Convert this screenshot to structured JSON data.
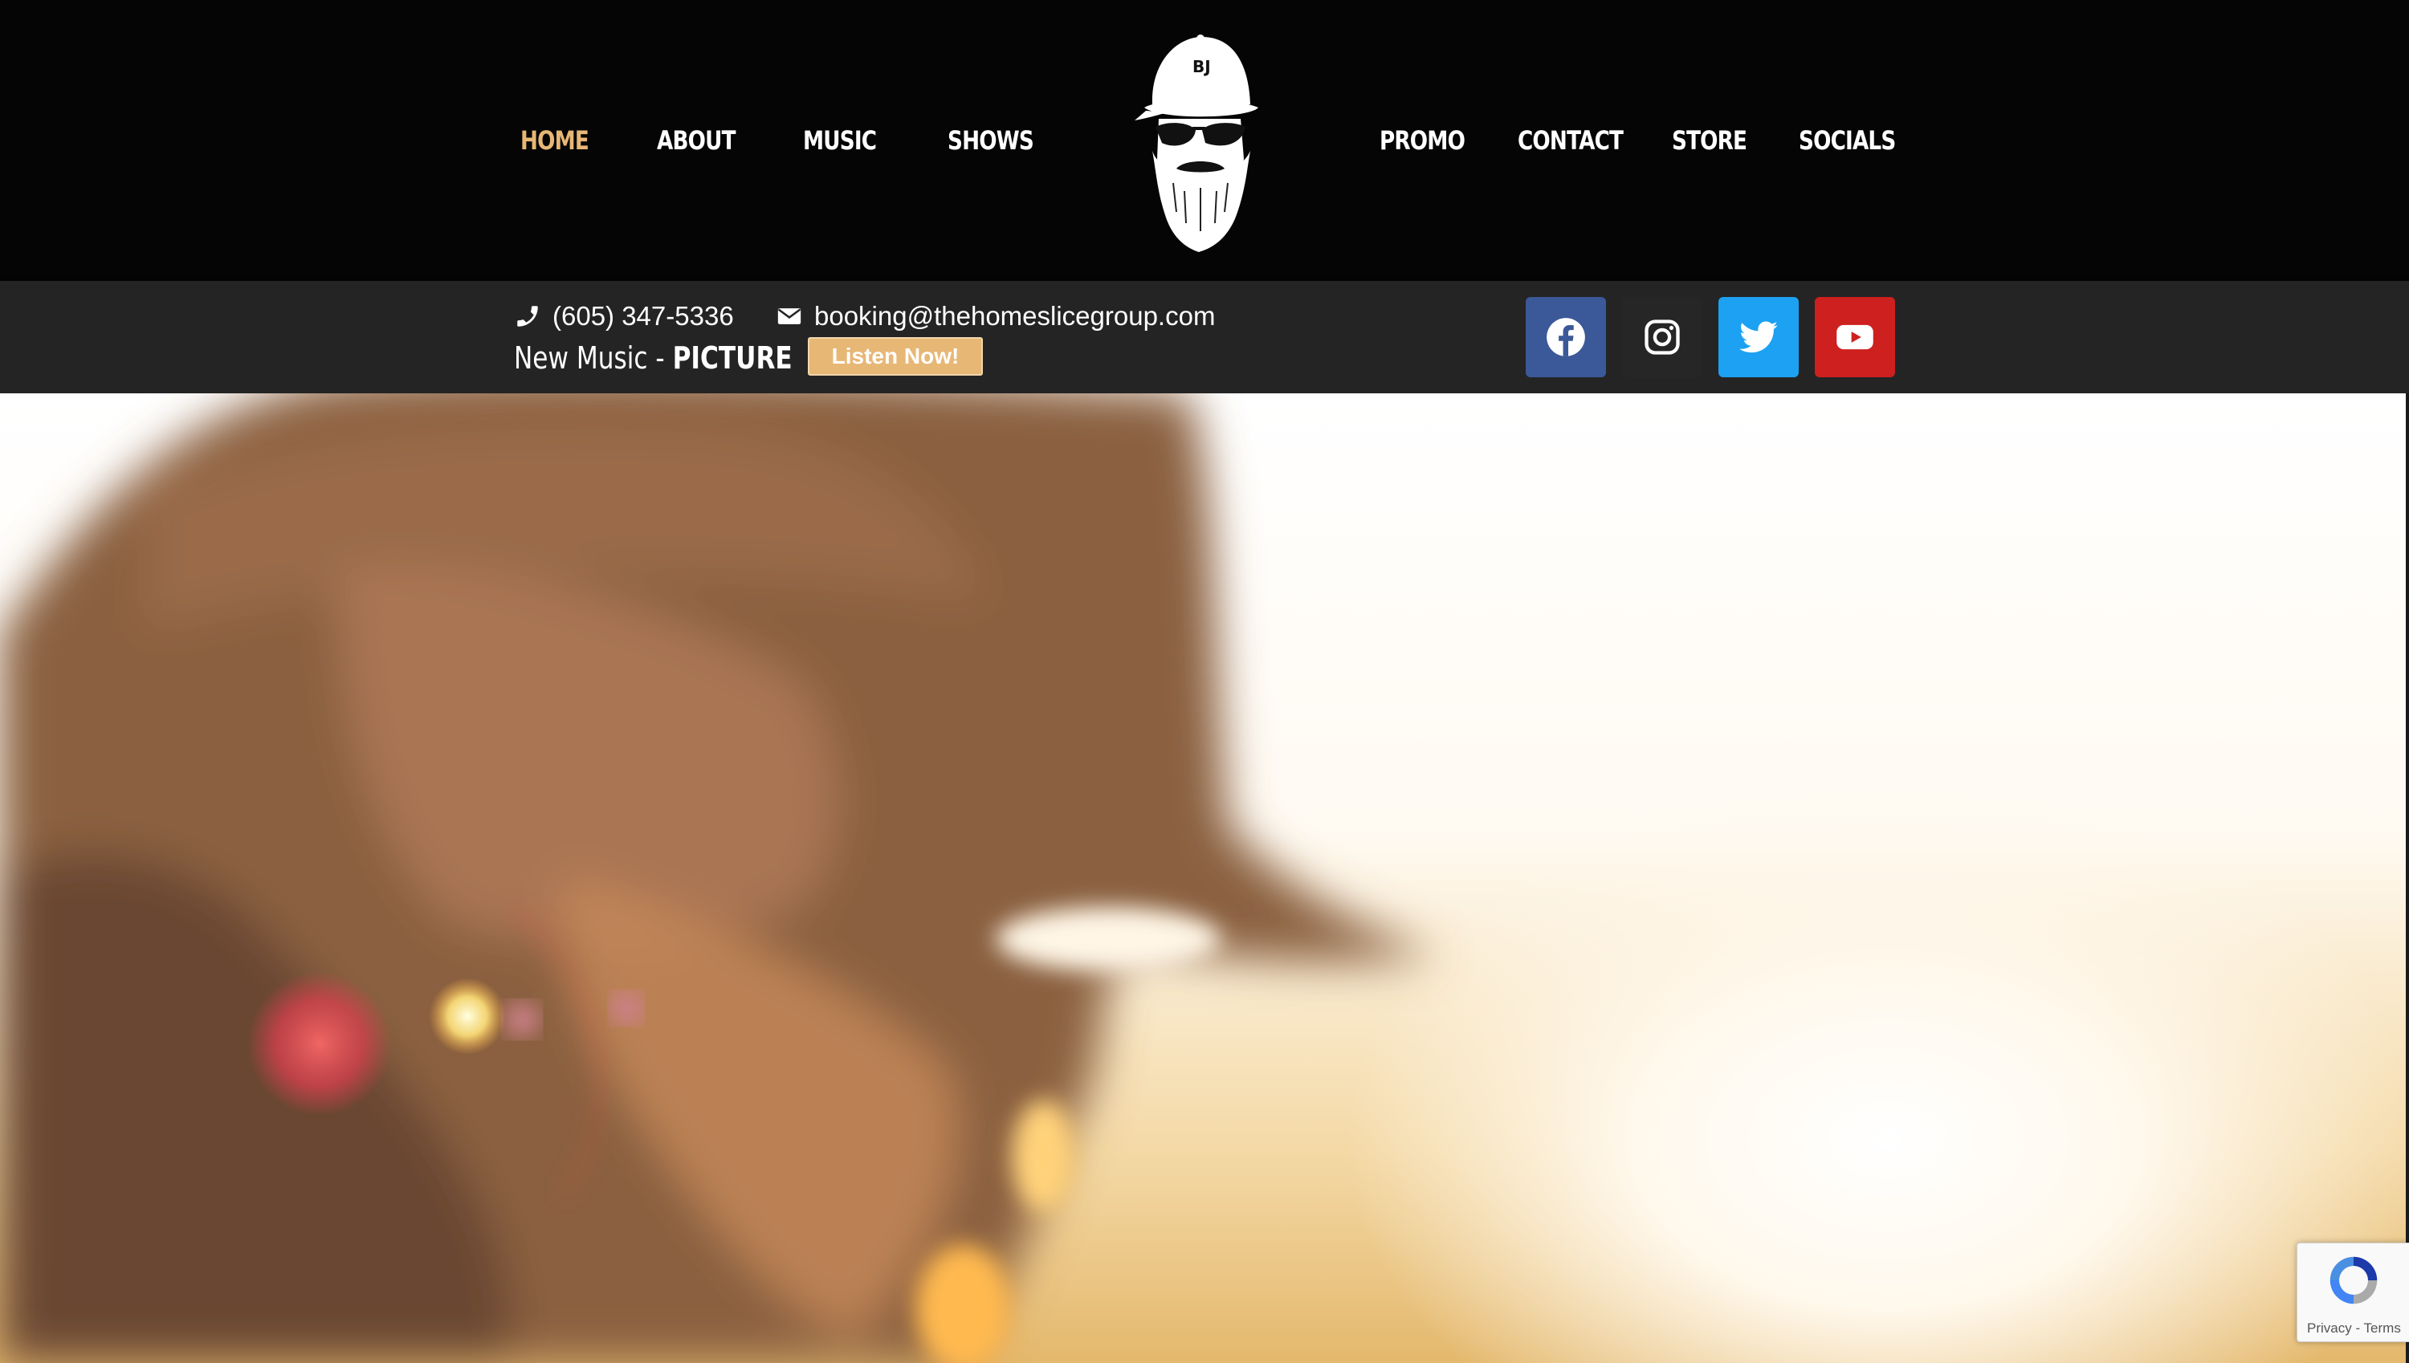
{
  "nav": {
    "left": [
      {
        "label": "HOME",
        "active": true
      },
      {
        "label": "ABOUT",
        "active": false
      },
      {
        "label": "MUSIC",
        "active": false
      },
      {
        "label": "SHOWS",
        "active": false
      }
    ],
    "right": [
      {
        "label": "PROMO",
        "active": false
      },
      {
        "label": "CONTACT",
        "active": false
      },
      {
        "label": "STORE",
        "active": false
      },
      {
        "label": "SOCIALS",
        "active": false
      }
    ],
    "active_color": "#e7b775",
    "logo": {
      "icon": "bearded-man-cap-logo",
      "cap_monogram": "BJ"
    }
  },
  "infobar": {
    "phone": {
      "icon": "phone-icon",
      "text": "(605) 347-5336"
    },
    "email": {
      "icon": "envelope-icon",
      "text": "booking@thehomeslicegroup.com"
    },
    "new_music": {
      "prefix": "New Music - ",
      "title": "PICTURE"
    },
    "listen_button": {
      "label": "Listen Now!",
      "color": "#e7b775"
    }
  },
  "socials": [
    {
      "name": "facebook-icon",
      "color": "#3b5998"
    },
    {
      "name": "instagram-icon",
      "color": "#262626"
    },
    {
      "name": "twitter-icon",
      "color": "#1da1f2"
    },
    {
      "name": "youtube-icon",
      "color": "#cd201f"
    }
  ],
  "recaptcha": {
    "privacy": "Privacy",
    "separator": " - ",
    "terms": "Terms"
  }
}
